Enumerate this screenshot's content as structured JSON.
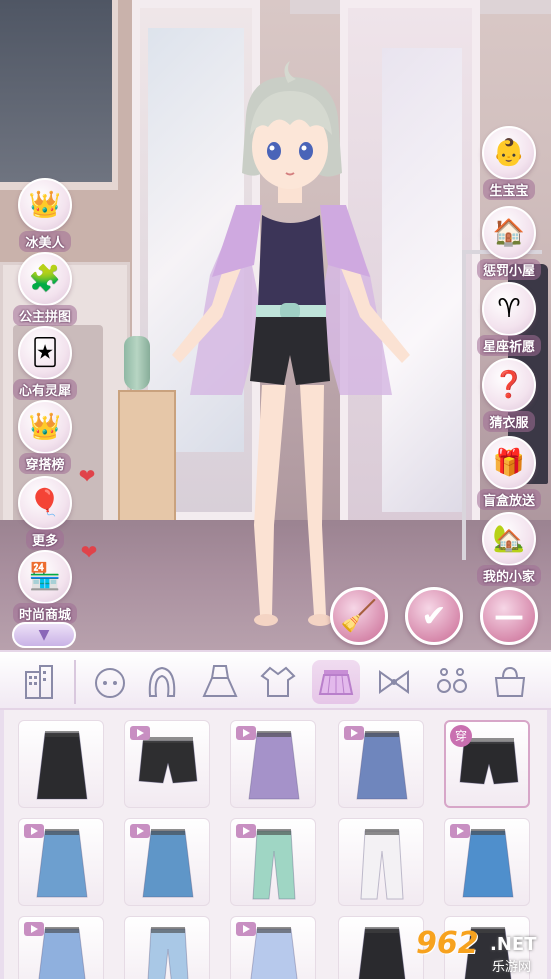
{
  "left_menu": [
    {
      "id": "bingmeiren",
      "label": "冰美人",
      "icon": "crown-sparkle-icon"
    },
    {
      "id": "gongzhupintu",
      "label": "公主拼图",
      "icon": "princess-puzzle-icon"
    },
    {
      "id": "xinyoulingxi",
      "label": "心有灵犀",
      "icon": "cards-icon"
    },
    {
      "id": "chuandabang",
      "label": "穿搭榜",
      "icon": "crown-ranking-icon"
    },
    {
      "id": "gengduo",
      "label": "更多",
      "icon": "balloons-icon"
    },
    {
      "id": "shishangshangcheng",
      "label": "时尚商城",
      "icon": "shop-icon"
    }
  ],
  "right_menu": [
    {
      "id": "shengbaobao",
      "label": "生宝宝",
      "icon": "baby-icon"
    },
    {
      "id": "chengfaxiaowu",
      "label": "惩罚小屋",
      "icon": "punish-house-icon"
    },
    {
      "id": "xingzuoqiyuan",
      "label": "星座祈愿",
      "icon": "zodiac-wish-icon"
    },
    {
      "id": "caiyifu",
      "label": "猜衣服",
      "icon": "guess-clothes-icon"
    },
    {
      "id": "manghefangsong",
      "label": "盲盒放送",
      "icon": "blind-box-icon"
    },
    {
      "id": "wodexiaojia",
      "label": "我的小家",
      "icon": "house-icon"
    }
  ],
  "action_buttons": [
    {
      "id": "clear",
      "icon": "brush-clean-icon"
    },
    {
      "id": "confirm",
      "icon": "checkmark-icon"
    },
    {
      "id": "remove",
      "icon": "minus-icon"
    }
  ],
  "categories": [
    {
      "id": "scene",
      "icon": "building-icon",
      "active": false
    },
    {
      "id": "face",
      "icon": "face-icon",
      "active": false
    },
    {
      "id": "hair",
      "icon": "hair-icon",
      "active": false
    },
    {
      "id": "dress",
      "icon": "dress-icon",
      "active": false
    },
    {
      "id": "top",
      "icon": "shirt-icon",
      "active": false
    },
    {
      "id": "bottom",
      "icon": "skirt-icon",
      "active": true
    },
    {
      "id": "bow",
      "icon": "bow-icon",
      "active": false
    },
    {
      "id": "earring",
      "icon": "earring-icon",
      "active": false
    },
    {
      "id": "bag",
      "icon": "bag-icon",
      "active": false
    }
  ],
  "items": [
    {
      "name": "black-lace-skirt",
      "video": false,
      "worn": false,
      "color": "#2b2b2e"
    },
    {
      "name": "black-shorts-yellow-belt",
      "video": true,
      "worn": false,
      "color": "#2e2e30"
    },
    {
      "name": "purple-wrap-skirt",
      "video": true,
      "worn": false,
      "color": "#a592c9"
    },
    {
      "name": "plaid-skirt",
      "video": true,
      "worn": false,
      "color": "#6f86bd"
    },
    {
      "name": "black-shorts-worn",
      "video": false,
      "worn": true,
      "color": "#2a2a2d"
    },
    {
      "name": "denim-long-skirt",
      "video": true,
      "worn": false,
      "color": "#6d9fcf"
    },
    {
      "name": "denim-mini-skirt",
      "video": true,
      "worn": false,
      "color": "#5f96c8"
    },
    {
      "name": "mint-jeans",
      "video": true,
      "worn": false,
      "color": "#9fd6c4"
    },
    {
      "name": "white-pants",
      "video": false,
      "worn": false,
      "color": "#f3f1f4"
    },
    {
      "name": "denim-button-skirt",
      "video": true,
      "worn": false,
      "color": "#4f8fcc"
    },
    {
      "name": "blue-bow-skirt",
      "video": true,
      "worn": false,
      "color": "#8fb0de"
    },
    {
      "name": "light-jeans",
      "video": false,
      "worn": false,
      "color": "#a9c8e6"
    },
    {
      "name": "angel-wing-skirt",
      "video": true,
      "worn": false,
      "color": "#b7c9ec"
    },
    {
      "name": "black-flare-skirt",
      "video": false,
      "worn": false,
      "color": "#2a2a2e"
    },
    {
      "name": "black-leather-skirt",
      "video": false,
      "worn": false,
      "color": "#303036"
    }
  ],
  "wear_badge_label": "穿",
  "watermark": {
    "number": "962",
    "net": ".NET",
    "sub": "乐游网"
  }
}
